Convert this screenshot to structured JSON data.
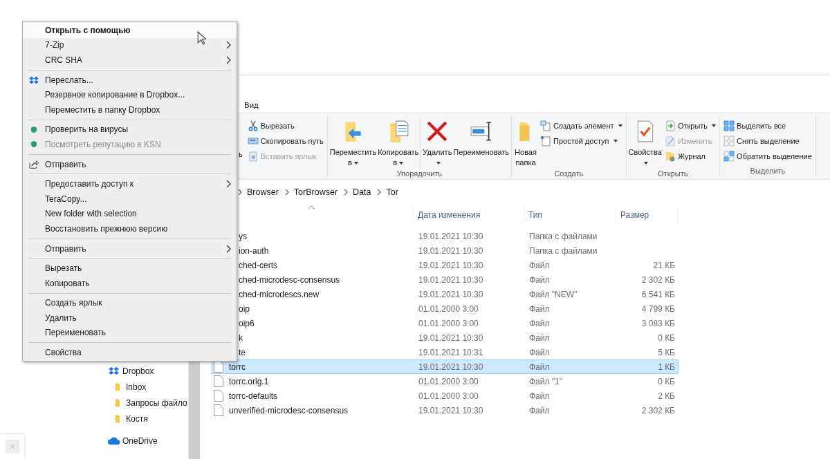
{
  "context_menu": {
    "sections": [
      [
        {
          "label": "Открыть с помощью",
          "kind": "plain",
          "bold": true,
          "highlighted": true,
          "disabled": false,
          "submenu": false
        },
        {
          "label": "7-Zip",
          "kind": "plain",
          "bold": false,
          "highlighted": false,
          "disabled": false,
          "submenu": true
        },
        {
          "label": "CRC SHA",
          "kind": "plain",
          "bold": false,
          "highlighted": false,
          "disabled": false,
          "submenu": true
        }
      ],
      [
        {
          "label": "Переслать...",
          "kind": "dropbox",
          "bold": false,
          "highlighted": false,
          "disabled": false,
          "submenu": false
        },
        {
          "label": "Резервное копирование в Dropbox...",
          "kind": "plain",
          "bold": false,
          "highlighted": false,
          "disabled": false,
          "submenu": false
        },
        {
          "label": "Переместить в папку Dropbox",
          "kind": "plain",
          "bold": false,
          "highlighted": false,
          "disabled": false,
          "submenu": false
        }
      ],
      [
        {
          "label": "Проверить на вирусы",
          "kind": "antivirus",
          "bold": false,
          "highlighted": false,
          "disabled": false,
          "submenu": false
        },
        {
          "label": "Посмотреть репутацию в KSN",
          "kind": "antivirus",
          "bold": false,
          "highlighted": false,
          "disabled": true,
          "submenu": false
        }
      ],
      [
        {
          "label": "Отправить",
          "kind": "share",
          "bold": false,
          "highlighted": false,
          "disabled": false,
          "submenu": false
        }
      ],
      [
        {
          "label": "Предоставить доступ к",
          "kind": "plain",
          "bold": false,
          "highlighted": false,
          "disabled": false,
          "submenu": true
        },
        {
          "label": "TeraCopy...",
          "kind": "plain",
          "bold": false,
          "highlighted": false,
          "disabled": false,
          "submenu": false
        },
        {
          "label": "New folder with selection",
          "kind": "plain",
          "bold": false,
          "highlighted": false,
          "disabled": false,
          "submenu": false
        },
        {
          "label": "Восстановить прежнюю версию",
          "kind": "plain",
          "bold": false,
          "highlighted": false,
          "disabled": false,
          "submenu": false
        }
      ],
      [
        {
          "label": "Отправить",
          "kind": "plain",
          "bold": false,
          "highlighted": false,
          "disabled": false,
          "submenu": true
        }
      ],
      [
        {
          "label": "Вырезать",
          "kind": "plain",
          "bold": false,
          "highlighted": false,
          "disabled": false,
          "submenu": false
        },
        {
          "label": "Копировать",
          "kind": "plain",
          "bold": false,
          "highlighted": false,
          "disabled": false,
          "submenu": false
        }
      ],
      [
        {
          "label": "Создать ярлык",
          "kind": "plain",
          "bold": false,
          "highlighted": false,
          "disabled": false,
          "submenu": false
        },
        {
          "label": "Удалить",
          "kind": "plain",
          "bold": false,
          "highlighted": false,
          "disabled": false,
          "submenu": false
        },
        {
          "label": "Переименовать",
          "kind": "plain",
          "bold": false,
          "highlighted": false,
          "disabled": false,
          "submenu": false
        }
      ],
      [
        {
          "label": "Свойства",
          "kind": "plain",
          "bold": false,
          "highlighted": false,
          "disabled": false,
          "submenu": false
        }
      ]
    ]
  },
  "explorer": {
    "tabs": [
      {
        "label": "Вид",
        "selected": false
      }
    ],
    "ribbon": {
      "groups": [
        {
          "fragment": "ь",
          "small": [
            {
              "label": "Вырезать",
              "dropdown": false,
              "disabled": false
            },
            {
              "label": "Скопировать путь",
              "dropdown": false,
              "disabled": false
            },
            {
              "label": "Вставить ярлык",
              "dropdown": false,
              "disabled": true
            }
          ]
        },
        {
          "label": "Упорядочить",
          "large": [
            {
              "label": "Переместить в",
              "dropdown": true
            },
            {
              "label": "Копировать в",
              "dropdown": true
            },
            {
              "label": "Удалить",
              "dropdown": true
            },
            {
              "label": "Переименовать",
              "dropdown": false
            }
          ]
        },
        {
          "label": "Создать",
          "large": [
            {
              "label": "Новая папка",
              "dropdown": false
            }
          ],
          "small": [
            {
              "label": "Создать элемент",
              "dropdown": true,
              "disabled": false
            },
            {
              "label": "Простой доступ",
              "dropdown": true,
              "disabled": false
            }
          ]
        },
        {
          "label": "Открыть",
          "large": [
            {
              "label": "Свойства",
              "dropdown": true
            }
          ],
          "small": [
            {
              "label": "Открыть",
              "dropdown": true,
              "disabled": false
            },
            {
              "label": "Изменить",
              "dropdown": false,
              "disabled": true
            },
            {
              "label": "Журнал",
              "dropdown": false,
              "disabled": false
            }
          ]
        },
        {
          "label": "Выделить",
          "small": [
            {
              "label": "Выделить все",
              "dropdown": false,
              "disabled": false
            },
            {
              "label": "Снять выделение",
              "dropdown": false,
              "disabled": false
            },
            {
              "label": "Обратить выделение",
              "dropdown": false,
              "disabled": false
            }
          ]
        }
      ]
    },
    "breadcrumb": [
      "Browser",
      "TorBrowser",
      "Data",
      "Tor"
    ],
    "columns": [
      "Дата изменения",
      "Тип",
      "Размер"
    ],
    "files": [
      {
        "name": "ys",
        "date": "19.01.2021 10:30",
        "type": "Папка с файлами",
        "selected": false,
        "icon_shown": false
      },
      {
        "name": "ion-auth",
        "date": "19.01.2021 10:30",
        "type": "Папка с файлами",
        "selected": false,
        "icon_shown": false
      },
      {
        "name": "ched-certs",
        "date": "19.01.2021 10:30",
        "type": "Файл",
        "size": "21 КБ",
        "selected": false,
        "icon_shown": false
      },
      {
        "name": "ched-microdesc-consensus",
        "date": "19.01.2021 10:30",
        "type": "Файл",
        "size": "2 302 КБ",
        "selected": false,
        "icon_shown": false
      },
      {
        "name": "ched-microdescs.new",
        "date": "19.01.2021 10:30",
        "type": "Файл \"NEW\"",
        "size": "6 541 КБ",
        "selected": false,
        "icon_shown": false
      },
      {
        "name": "oip",
        "date": "01.01.2000 3:00",
        "type": "Файл",
        "size": "4 799 КБ",
        "selected": false,
        "icon_shown": false
      },
      {
        "name": "oip6",
        "date": "01.01.2000 3:00",
        "type": "Файл",
        "size": "3 083 КБ",
        "selected": false,
        "icon_shown": false
      },
      {
        "name": "k",
        "date": "19.01.2021 10:30",
        "type": "Файл",
        "size": "0 КБ",
        "selected": false,
        "icon_shown": false
      },
      {
        "name": "te",
        "date": "19.01.2021 10:31",
        "type": "Файл",
        "size": "5 КБ",
        "selected": false,
        "icon_shown": false
      },
      {
        "name": "torrc",
        "date": "19.01.2021 10:30",
        "type": "Файл",
        "size": "1 КБ",
        "selected": true,
        "icon_shown": true
      },
      {
        "name": "torrc.orig.1",
        "date": "01.01.2000 3:00",
        "type": "Файл \"1\"",
        "size": "0 КБ",
        "selected": false,
        "icon_shown": true
      },
      {
        "name": "torrc-defaults",
        "date": "01.01.2000 3:00",
        "type": "Файл",
        "size": "2 КБ",
        "selected": false,
        "icon_shown": true
      },
      {
        "name": "unverified-microdesc-consensus",
        "date": "19.01.2021 10:30",
        "type": "Файл",
        "size": "2 302 КБ",
        "selected": false,
        "icon_shown": true
      }
    ],
    "nav": [
      {
        "label": "Dropbox",
        "children": [
          {
            "label": "Inbox"
          },
          {
            "label": "Запросы файло"
          },
          {
            "label": "Костя"
          }
        ]
      },
      {
        "label": "OneDrive"
      }
    ]
  }
}
